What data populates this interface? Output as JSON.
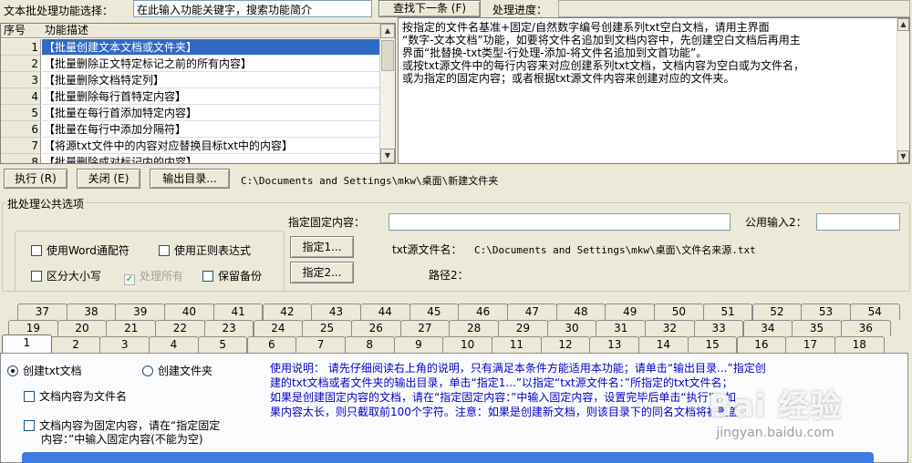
{
  "toolbar": {
    "search_label": "文本批处理功能选择：",
    "search_value": "在此输入功能关键字，搜索功能简介",
    "find_next": "查找下一条 (F)",
    "progress_label": "处理进度："
  },
  "list": {
    "col_num": "序号",
    "col_desc": "功能描述",
    "rows": [
      {
        "num": "1",
        "desc": "【批量创建文本文档或文件夹】"
      },
      {
        "num": "2",
        "desc": "【批量删除正文特定标记之前的所有内容】"
      },
      {
        "num": "3",
        "desc": "【批量删除文档特定列】"
      },
      {
        "num": "4",
        "desc": "【批量删除每行首特定内容】"
      },
      {
        "num": "5",
        "desc": "【批量在每行首添加特定内容】"
      },
      {
        "num": "6",
        "desc": "【批量在每行中添加分隔符】"
      },
      {
        "num": "7",
        "desc": "【将源txt文件中的内容对应替换目标txt中的内容】"
      },
      {
        "num": "8",
        "desc": "【批量删除成对标记内的内容】"
      }
    ]
  },
  "description": {
    "lines": [
      "按指定的文件名基准+固定/自然数字编号创建系列txt空白文档，请用主界面",
      "“数字-文本文档”功能，如要将文件名追加到文档内容中，先创建空白文档后再用主",
      "界面“批替换-txt类型-行处理-添加-将文件名追加到文首功能”。",
      "或按txt源文件中的每行内容来对应创建系列txt文档，文档内容为空白或为文件名，",
      "或为指定的固定内容；或者根据txt源文件内容来创建对应的文件夹。"
    ]
  },
  "actions": {
    "execute": "执行 (R)",
    "close": "关闭 (E)",
    "output_dir": "输出目录...",
    "output_path": "C:\\Documents and Settings\\mkw\\桌面\\新建文件夹"
  },
  "common": {
    "group_title": "批处理公共选项",
    "fixed_content_label": "指定固定内容：",
    "fixed_content_value": "",
    "public_input2_label": "公用输入2：",
    "public_input2_value": "",
    "use_word_wildcard": "使用Word通配符",
    "use_regex": "使用正则表达式",
    "case_sensitive": "区分大小写",
    "process_all": "处理所有",
    "keep_backup": "保留备份",
    "assign1": "指定1...",
    "assign2": "指定2...",
    "txt_source_label": "txt源文件名：",
    "txt_source_value": "C:\\Documents and Settings\\mkw\\桌面\\文件名来源.txt",
    "path2_label": "路径2："
  },
  "tabs": {
    "row1": [
      "37",
      "38",
      "39",
      "40",
      "41",
      "42",
      "43",
      "44",
      "45",
      "46",
      "47",
      "48",
      "49",
      "50",
      "51",
      "52",
      "53",
      "54"
    ],
    "row2": [
      "19",
      "20",
      "21",
      "22",
      "23",
      "24",
      "25",
      "26",
      "27",
      "28",
      "29",
      "30",
      "31",
      "32",
      "33",
      "34",
      "35",
      "36"
    ],
    "row3": [
      "1",
      "2",
      "3",
      "4",
      "5",
      "6",
      "7",
      "8",
      "9",
      "10",
      "11",
      "12",
      "13",
      "14",
      "15",
      "16",
      "17",
      "18"
    ],
    "active": "1"
  },
  "panel": {
    "radio_txt": "创建txt文档",
    "radio_folder": "创建文件夹",
    "chk_content_filename": "文档内容为文件名",
    "chk_fixed_line1": "文档内容为固定内容，请在“指定固定",
    "chk_fixed_line2": "内容：”中输入固定内容(不能为空)",
    "help_lines": [
      "使用说明：  请先仔细阅读右上角的说明，只有满足本条件方能适用本功能；请单击“输出目录...”指定创",
      "建的txt文档或者文件夹的输出目录，单击“指定1...”以指定“txt源文件名：”所指定的txt文件名；",
      "如果是创建固定内容的文档，请在“指定固定内容：”中输入固定内容，设置完毕后单击“执行”；如",
      "果内容太长，则只截取前100个字符。注意：如果是创建新文档，则该目录下的同名文档将被覆盖。"
    ]
  },
  "watermark": {
    "logo": "Bai 经验",
    "url": "jingyan.baidu.com"
  }
}
